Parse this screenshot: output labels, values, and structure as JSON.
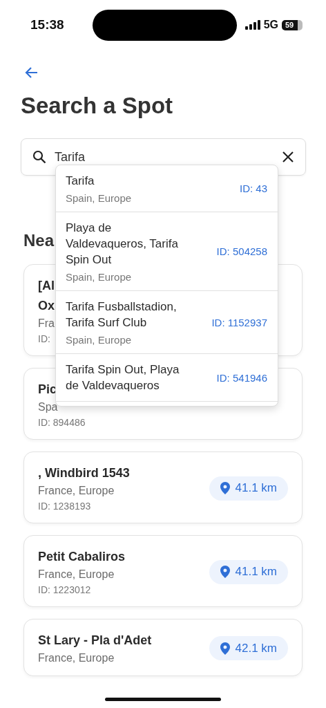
{
  "status_bar": {
    "time": "15:38",
    "network": "5G",
    "battery": "59"
  },
  "title": "Search a Spot",
  "search": {
    "value": "Tarifa"
  },
  "suggestions": [
    {
      "name_lines": [
        "Tarifa"
      ],
      "region": "Spain, Europe",
      "id": "ID: 43"
    },
    {
      "name_lines": [
        "Playa de",
        "Valdevaqueros, Tarifa",
        "Spin Out"
      ],
      "region": "Spain, Europe",
      "id": "ID: 504258"
    },
    {
      "name_lines": [
        "Tarifa Fusballstadion,",
        "Tarifa Surf Club"
      ],
      "region": "Spain, Europe",
      "id": "ID: 1152937"
    },
    {
      "name_lines": [
        "Tarifa Spin Out, Playa",
        "de Valdevaqueros"
      ],
      "id": "ID: 541946"
    }
  ],
  "section_title": "Nea",
  "spots": [
    {
      "title_lines": [
        "[Al",
        "Ox"
      ],
      "region": "Fra",
      "id": "ID: "
    },
    {
      "title_lines": [
        "Pic"
      ],
      "region": "Spa",
      "id": "ID: 894486"
    },
    {
      "title_lines": [
        ", Windbird 1543"
      ],
      "region": "France, Europe",
      "id": "ID: 1238193",
      "distance": "41.1 km"
    },
    {
      "title_lines": [
        "Petit Cabaliros"
      ],
      "region": "France, Europe",
      "id": "ID: 1223012",
      "distance": "41.1 km"
    },
    {
      "title_lines": [
        "St Lary - Pla d'Adet"
      ],
      "region": "France, Europe",
      "distance": "42.1 km"
    }
  ]
}
